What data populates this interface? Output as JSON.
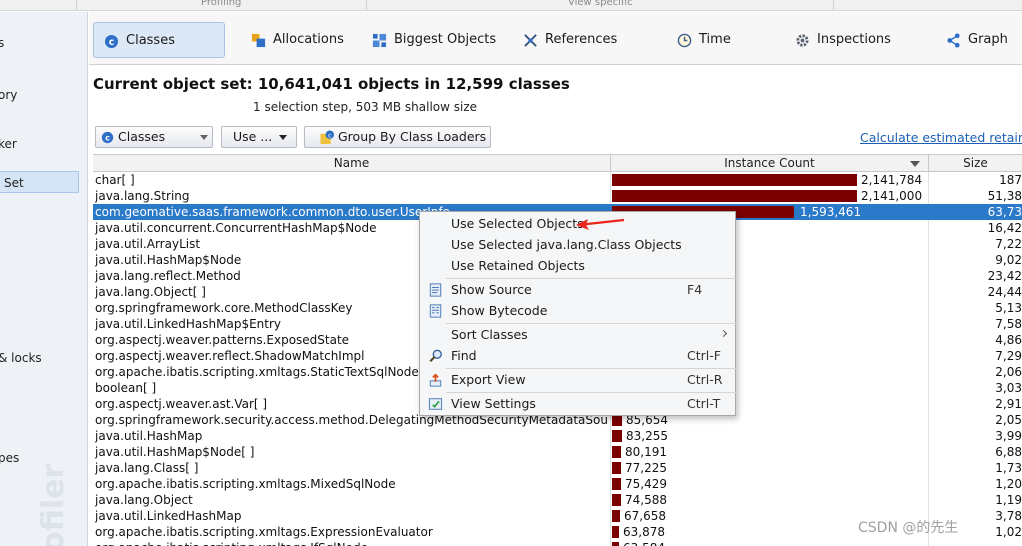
{
  "sections": {
    "profiling": "Profiling",
    "view_specific": "View specific"
  },
  "sidebar": {
    "items": [
      {
        "label": "s",
        "active": false
      },
      {
        "label": "ory",
        "active": false
      },
      {
        "label": "ker",
        "active": false
      },
      {
        "label": "Set",
        "active": true
      },
      {
        "label": "& locks",
        "active": false
      },
      {
        "label": "pes",
        "active": false
      }
    ],
    "watermark": "ofiler"
  },
  "tabs": [
    {
      "label": "Classes",
      "icon": "classes-icon",
      "active": true
    },
    {
      "label": "Allocations",
      "icon": "allocations-icon",
      "active": false
    },
    {
      "label": "Biggest Objects",
      "icon": "biggest-objects-icon",
      "active": false
    },
    {
      "label": "References",
      "icon": "references-icon",
      "active": false
    },
    {
      "label": "Time",
      "icon": "clock-icon",
      "active": false
    },
    {
      "label": "Inspections",
      "icon": "gear-icon",
      "active": false
    },
    {
      "label": "Graph",
      "icon": "share-icon",
      "active": false
    }
  ],
  "header": {
    "title": "Current object set:  10,641,041 objects in 12,599 classes",
    "subtitle": "1 selection step, 503 MB shallow size"
  },
  "toolbar": {
    "view_select": "Classes",
    "use_button": "Use ...",
    "group_button": "Group By Class Loaders",
    "calc_link": "Calculate estimated retained"
  },
  "table": {
    "columns": {
      "name": "Name",
      "count": "Instance Count",
      "size": "Size"
    },
    "max_count": 2141784,
    "rows": [
      {
        "name": "char[ ]",
        "count": 2141784,
        "count_text": "2,141,784",
        "size": "187"
      },
      {
        "name": "java.lang.String",
        "count": 2141000,
        "count_text": "2,141,000",
        "size": "51,38"
      },
      {
        "name": "com.geomative.saas.framework.common.dto.user.UserInfo",
        "count": 1593461,
        "count_text": "1,593,461",
        "size": "63,73",
        "selected": true
      },
      {
        "name": "java.util.concurrent.ConcurrentHashMap$Node",
        "count": 0,
        "count_text": "",
        "size": "16,42"
      },
      {
        "name": "java.util.ArrayList",
        "count": 0,
        "count_text": "",
        "size": "7,22"
      },
      {
        "name": "java.util.HashMap$Node",
        "count": 0,
        "count_text": "",
        "size": "9,02"
      },
      {
        "name": "java.lang.reflect.Method",
        "count": 0,
        "count_text": "",
        "size": "23,42"
      },
      {
        "name": "java.lang.Object[ ]",
        "count": 0,
        "count_text": "",
        "size": "24,44"
      },
      {
        "name": "org.springframework.core.MethodClassKey",
        "count": 0,
        "count_text": "",
        "size": "5,13"
      },
      {
        "name": "java.util.LinkedHashMap$Entry",
        "count": 0,
        "count_text": "",
        "size": "7,58"
      },
      {
        "name": "org.aspectj.weaver.patterns.ExposedState",
        "count": 0,
        "count_text": "",
        "size": "4,86"
      },
      {
        "name": "org.aspectj.weaver.reflect.ShadowMatchImpl",
        "count": 0,
        "count_text": "",
        "size": "7,29"
      },
      {
        "name": "org.apache.ibatis.scripting.xmltags.StaticTextSqlNode",
        "count": 0,
        "count_text": "",
        "size": "2,06"
      },
      {
        "name": "boolean[ ]",
        "count": 0,
        "count_text": "",
        "size": "3,03"
      },
      {
        "name": "org.aspectj.weaver.ast.Var[ ]",
        "count": 0,
        "count_text": "",
        "size": "2,91"
      },
      {
        "name": "org.springframework.security.access.method.DelegatingMethodSecurityMetadataSour...",
        "count": 85654,
        "count_text": "85,654",
        "size": "2,05"
      },
      {
        "name": "java.util.HashMap",
        "count": 83255,
        "count_text": "83,255",
        "size": "3,99"
      },
      {
        "name": "java.util.HashMap$Node[ ]",
        "count": 80191,
        "count_text": "80,191",
        "size": "6,88"
      },
      {
        "name": "java.lang.Class[ ]",
        "count": 77225,
        "count_text": "77,225",
        "size": "1,73"
      },
      {
        "name": "org.apache.ibatis.scripting.xmltags.MixedSqlNode",
        "count": 75429,
        "count_text": "75,429",
        "size": "1,20"
      },
      {
        "name": "java.lang.Object",
        "count": 74588,
        "count_text": "74,588",
        "size": "1,19"
      },
      {
        "name": "java.util.LinkedHashMap",
        "count": 67658,
        "count_text": "67,658",
        "size": "3,78"
      },
      {
        "name": "org.apache.ibatis.scripting.xmltags.ExpressionEvaluator",
        "count": 63878,
        "count_text": "63,878",
        "size": "1,02"
      },
      {
        "name": "org.apache.ibatis.scripting.xmltags.IfSqlNode",
        "count": 63584,
        "count_text": "63,584",
        "size": ""
      }
    ]
  },
  "context_menu": {
    "items": [
      {
        "label": "Use Selected Objects",
        "shortcut": "",
        "icon": ""
      },
      {
        "label": "Use Selected java.lang.Class Objects",
        "shortcut": "",
        "icon": ""
      },
      {
        "label": "Use Retained Objects",
        "shortcut": "",
        "icon": ""
      },
      {
        "label": "Show Source",
        "shortcut": "F4",
        "icon": "source-icon"
      },
      {
        "label": "Show Bytecode",
        "shortcut": "",
        "icon": "bytecode-icon"
      },
      {
        "label": "Sort Classes",
        "shortcut": "",
        "icon": "",
        "submenu": true
      },
      {
        "label": "Find",
        "shortcut": "Ctrl-F",
        "icon": "search-icon"
      },
      {
        "label": "Export View",
        "shortcut": "Ctrl-R",
        "icon": "export-icon"
      },
      {
        "label": "View Settings",
        "shortcut": "Ctrl-T",
        "icon": "settings-icon"
      }
    ]
  },
  "colors": {
    "bar": "#7b0000",
    "selection": "#2b79c9",
    "accent_link": "#1a5fb4"
  },
  "watermark": "CSDN @的先生"
}
